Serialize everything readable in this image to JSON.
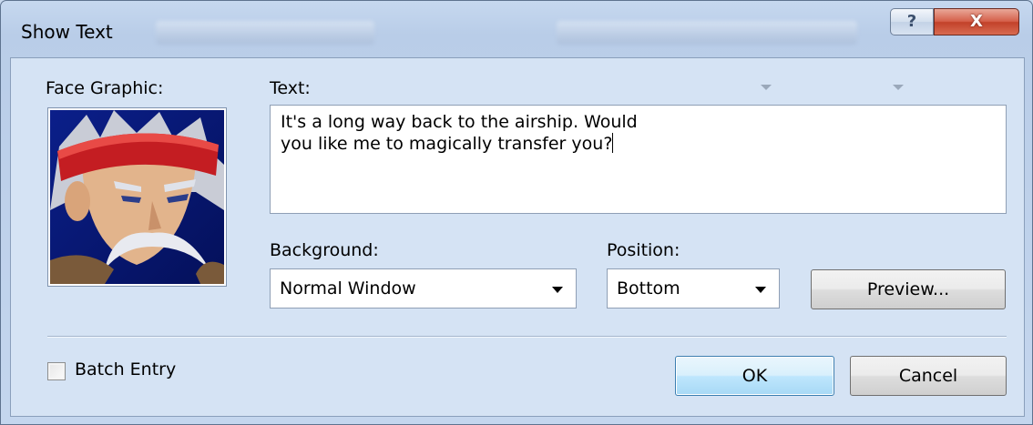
{
  "window": {
    "title": "Show Text",
    "help_glyph": "?",
    "close_glyph": "X"
  },
  "face": {
    "label": "Face Graphic:"
  },
  "text": {
    "label": "Text:",
    "value": "It's a long way back to the airship. Would\nyou like me to magically transfer you?"
  },
  "background": {
    "label": "Background:",
    "selected": "Normal Window"
  },
  "position": {
    "label": "Position:",
    "selected": "Bottom"
  },
  "preview": {
    "label": "Preview..."
  },
  "batch": {
    "label": "Batch Entry",
    "checked": false
  },
  "footer": {
    "ok_label": "OK",
    "cancel_label": "Cancel"
  }
}
